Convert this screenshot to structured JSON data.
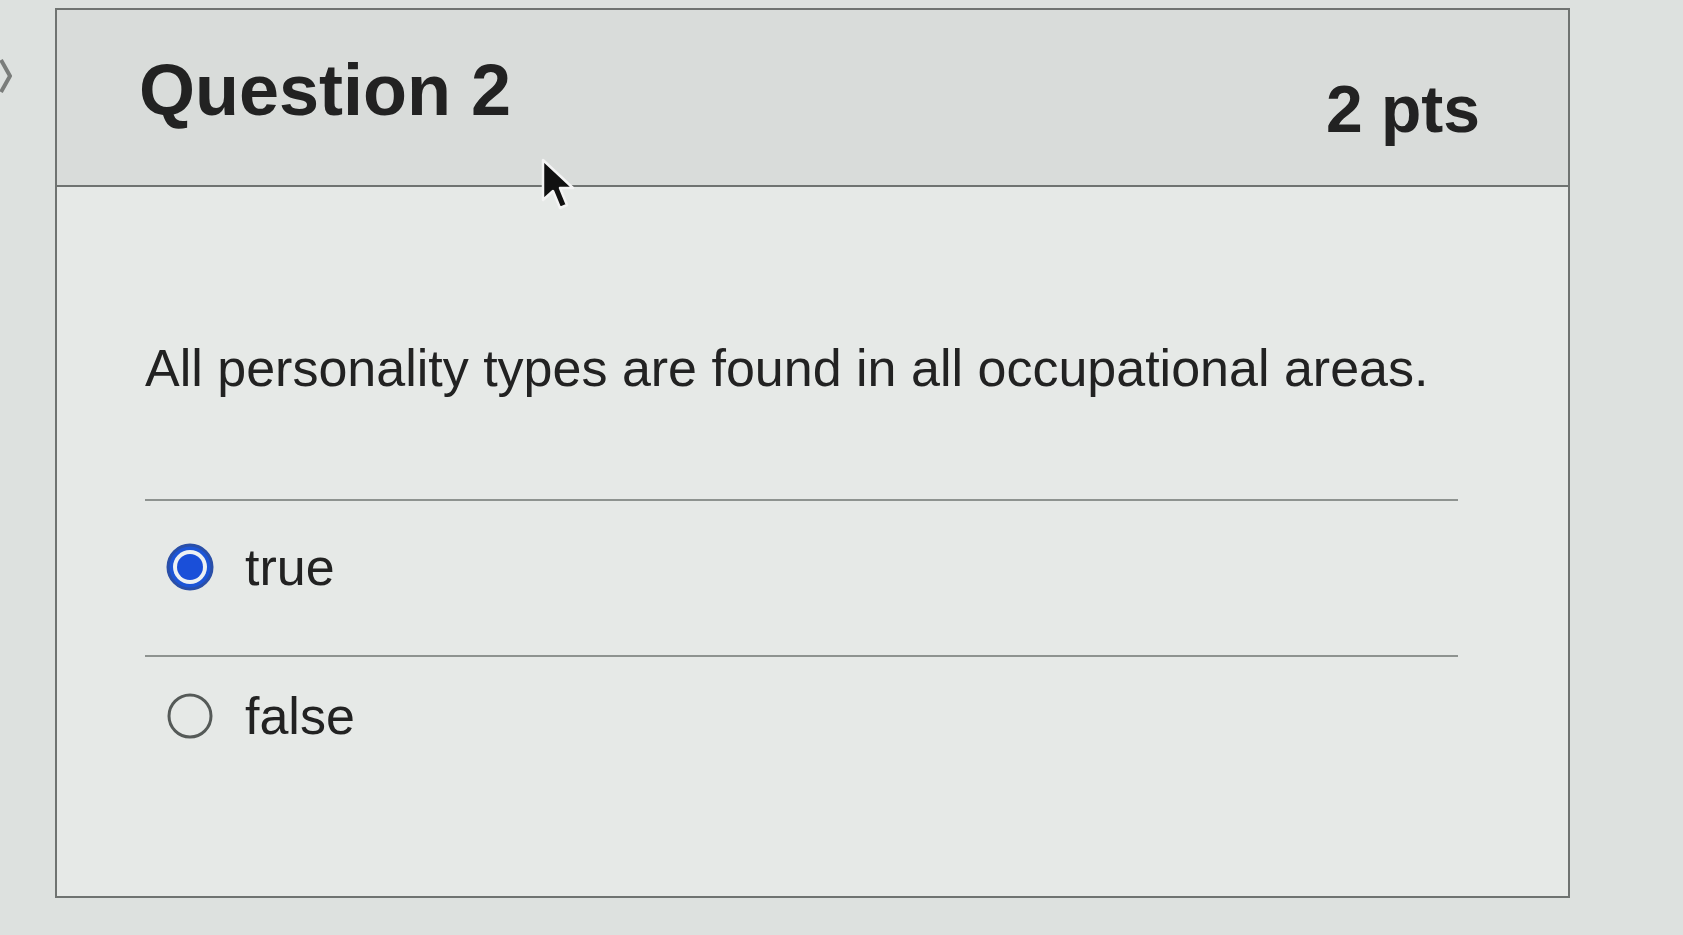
{
  "question": {
    "title": "Question 2",
    "points": "2 pts",
    "text": "All personality types are found in all occupational areas."
  },
  "answers": [
    {
      "label": "true",
      "selected": true
    },
    {
      "label": "false",
      "selected": false
    }
  ]
}
